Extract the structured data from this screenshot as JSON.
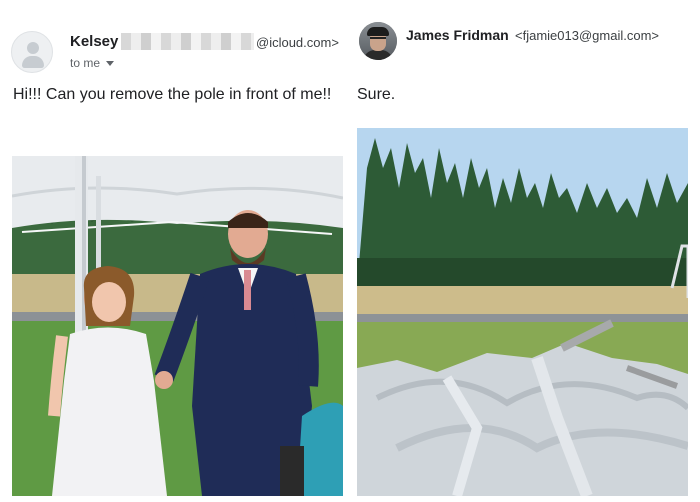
{
  "left_email": {
    "sender_name": "Kelsey",
    "sender_domain": "@icloud.com>",
    "recipient": "to me",
    "message": "Hi!!! Can you remove the pole in front of me!!"
  },
  "right_email": {
    "sender_name": "James Fridman",
    "sender_email": "<fjamie013@gmail.com>",
    "message": "Sure."
  },
  "icons": {
    "left_avatar": "default-person-icon",
    "right_avatar": "profile-photo",
    "recipient_caret": "caret-down-icon"
  },
  "colors": {
    "text_primary": "#202124",
    "text_secondary": "#5f6368",
    "suit_navy": "#1f2c57",
    "tent_white": "#e9ecef",
    "tree_green": "#2d5b36",
    "sky_blue": "#b7d6ef"
  }
}
